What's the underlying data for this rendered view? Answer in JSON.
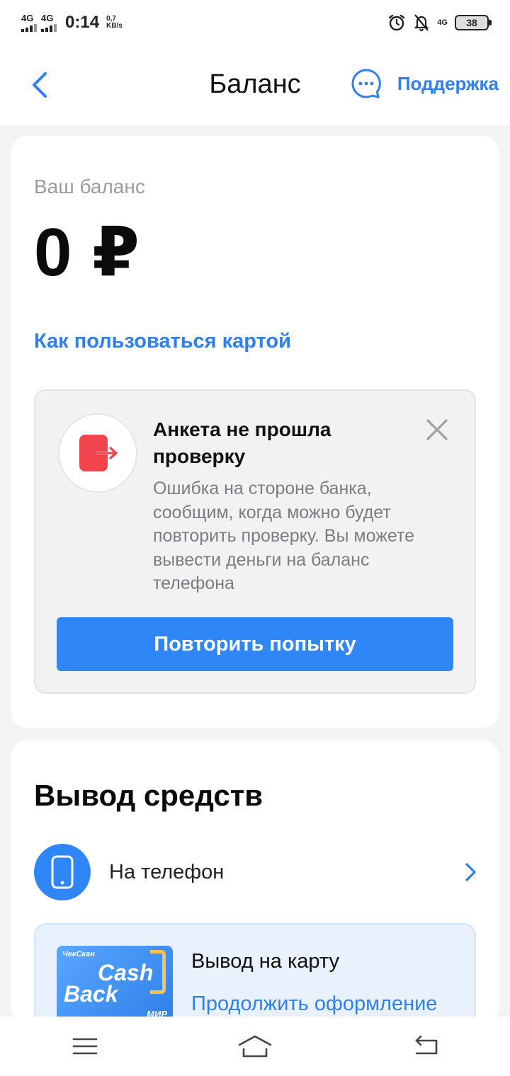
{
  "status_bar": {
    "net1": "4G",
    "net2": "4G",
    "time": "0:14",
    "speed_value": "0,7",
    "speed_unit": "KB/s",
    "net_right": "4G",
    "battery": "38"
  },
  "header": {
    "title": "Баланс",
    "support_label": "Поддержка"
  },
  "balance": {
    "label": "Ваш баланс",
    "amount": "0 ₽",
    "howto_link": "Как пользоваться картой"
  },
  "alert": {
    "title": "Анкета не прошла проверку",
    "text": "Ошибка на стороне банка, сообщим, когда можно будет повторить проверку. Вы можете вывести деньги на баланс телефона",
    "button": "Повторить попытку"
  },
  "withdraw": {
    "title": "Вывод средств",
    "phone_label": "На телефон",
    "card_title": "Вывод на карту",
    "card_link": "Продолжить оформление",
    "card_image": {
      "brand": "ЧекСкан",
      "line1": "Cash",
      "line2": "Back",
      "network": "МИР"
    }
  },
  "colors": {
    "accent": "#2f80ed",
    "button": "#2f86f6",
    "error_red": "#f2444c"
  }
}
